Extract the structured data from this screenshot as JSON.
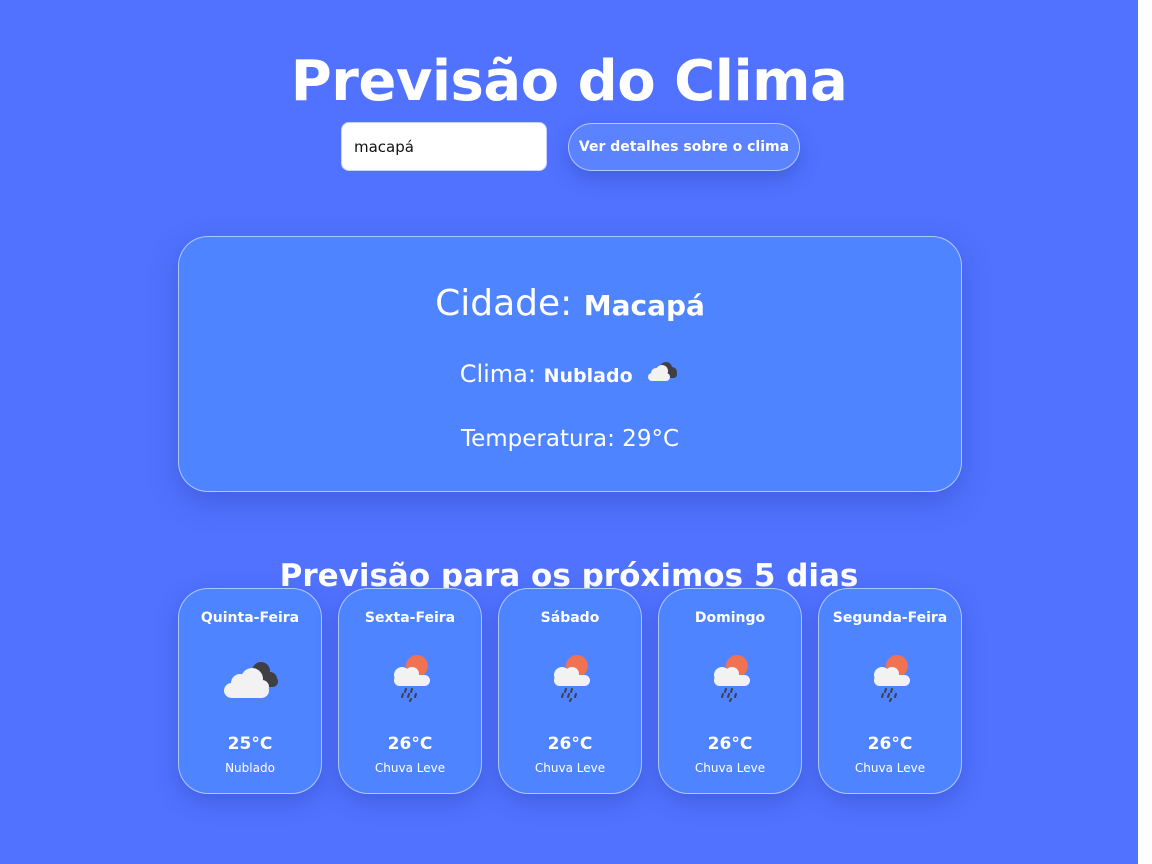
{
  "header": {
    "title": "Previsão do Clima"
  },
  "search": {
    "value": "macapá",
    "button_label": "Ver detalhes sobre o clima"
  },
  "current": {
    "city_label": "Cidade:",
    "city": "Macapá",
    "condition_label": "Clima:",
    "condition": "Nublado",
    "condition_icon": "cloudy-icon",
    "temperature_text": "Temperatura: 29°C"
  },
  "forecast": {
    "title": "Previsão para os próximos 5 dias",
    "days": [
      {
        "day": "Quinta-Feira",
        "temp": "25°C",
        "desc": "Nublado",
        "icon": "cloudy-icon"
      },
      {
        "day": "Sexta-Feira",
        "temp": "26°C",
        "desc": "Chuva Leve",
        "icon": "light-rain-sun-icon"
      },
      {
        "day": "Sábado",
        "temp": "26°C",
        "desc": "Chuva Leve",
        "icon": "light-rain-sun-icon"
      },
      {
        "day": "Domingo",
        "temp": "26°C",
        "desc": "Chuva Leve",
        "icon": "light-rain-sun-icon"
      },
      {
        "day": "Segunda-Feira",
        "temp": "26°C",
        "desc": "Chuva Leve",
        "icon": "light-rain-sun-icon"
      }
    ]
  },
  "colors": {
    "background": "#5072ff",
    "card": "#4e84ff",
    "sun": "#f07250",
    "cloud_light": "#f2f2f2",
    "cloud_dark": "#3f3f45"
  }
}
